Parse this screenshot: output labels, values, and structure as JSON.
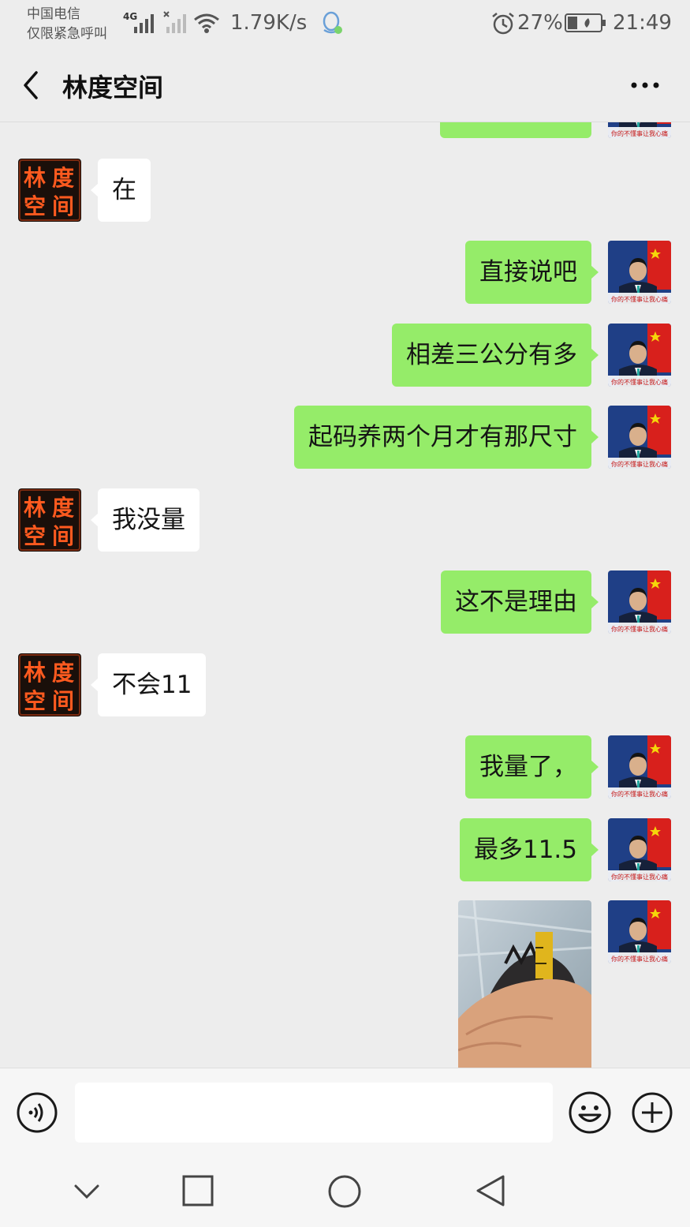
{
  "status_bar": {
    "carrier_line1": "中国电信",
    "carrier_line2": "仅限紧急呼叫",
    "network_type": "4G",
    "net_speed": "1.79K/s",
    "battery_percent": "27%",
    "time": "21:49"
  },
  "header": {
    "title": "林度空间"
  },
  "avatars": {
    "contact_chars": [
      "林",
      "度",
      "空",
      "间"
    ],
    "self_caption": "你的不懂事让我心痛"
  },
  "messages": [
    {
      "side": "left",
      "text": "在"
    },
    {
      "side": "right",
      "text": "直接说吧"
    },
    {
      "side": "right",
      "text": "相差三公分有多"
    },
    {
      "side": "right",
      "text": "起码养两个月才有那尺寸"
    },
    {
      "side": "left",
      "text": "我没量"
    },
    {
      "side": "right",
      "text": "这不是理由"
    },
    {
      "side": "left",
      "text": "不会11"
    },
    {
      "side": "right",
      "text": "我量了，"
    },
    {
      "side": "right",
      "text": "最多11.5"
    },
    {
      "side": "right",
      "type": "image"
    }
  ],
  "input": {
    "placeholder": ""
  },
  "icons": {
    "back": "chevron-left-icon",
    "more": "more-dots-icon",
    "voice": "voice-icon",
    "emoji": "emoji-icon",
    "plus": "plus-icon",
    "nav_down": "chevron-down-icon",
    "nav_recent": "square-icon",
    "nav_home": "circle-icon",
    "nav_back": "triangle-back-icon"
  },
  "colors": {
    "background": "#ededed",
    "outgoing_bubble": "#95ec69",
    "incoming_bubble": "#ffffff",
    "contact_avatar_bg": "#1a0f0a",
    "contact_avatar_text": "#ff5a1f"
  }
}
